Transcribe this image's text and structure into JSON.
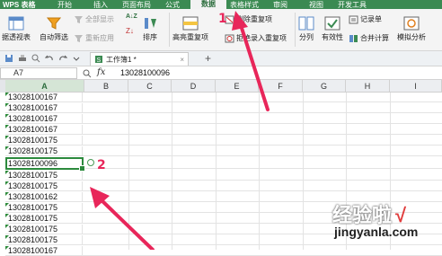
{
  "menu": {
    "app_logo": "WPS 表格",
    "tabs": [
      "开始",
      "插入",
      "页面布局",
      "公式",
      "数据",
      "表格样式",
      "审阅",
      "视图",
      "开发工具"
    ],
    "active_tab": "数据"
  },
  "ribbon": {
    "pivot": "据透视表",
    "autofilter": "自动筛选",
    "show_all": "全部显示",
    "reapply": "重新应用",
    "sort": "排序",
    "highlight_dup": "高亮重复项",
    "delete_dup": "删除重复项",
    "reject_dup": "拒绝录入重复项",
    "split": "分列",
    "validity": "有效性",
    "record": "记录单",
    "consolidate": "合并计算",
    "simulate": "模拟分析",
    "sort_az": "A↓Z"
  },
  "tabbar": {
    "doc_tab": "工作簿1 *",
    "add_tab": "+"
  },
  "formula_bar": {
    "name_box": "A7",
    "fx": "fx",
    "value": "13028100096"
  },
  "columns": [
    "A",
    "B",
    "C",
    "D",
    "E",
    "F",
    "G",
    "H",
    "I"
  ],
  "active_column": "A",
  "rows": [
    "13028100167",
    "13028100167",
    "13028100167",
    "13028100167",
    "13028100175",
    "13028100175",
    "13028100096",
    "13028100175",
    "13028100175",
    "13028100162",
    "13028100175",
    "13028100175",
    "13028100175",
    "13028100175",
    "13028100167",
    "13028100175"
  ],
  "annotations": {
    "label_1": "1",
    "label_2": "2",
    "arrow_color": "#e8265a"
  },
  "watermark": {
    "text": "经验啦",
    "check": "√",
    "url": "jingyanla.com"
  },
  "colors": {
    "menu_bar": "#3b8a52",
    "selection": "#2c8a3d",
    "annotation": "#e8265a"
  }
}
